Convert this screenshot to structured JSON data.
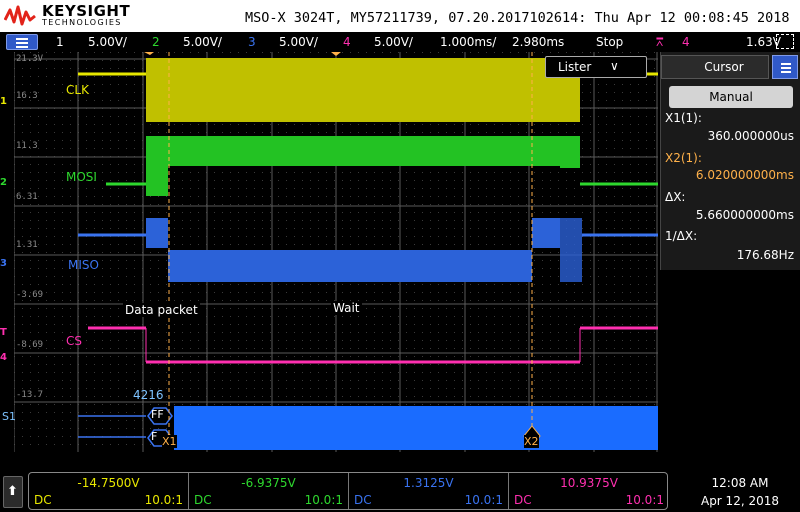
{
  "header": {
    "brand": "KEYSIGHT",
    "brand_sub": "TECHNOLOGIES",
    "model_line": "MSO-X 3024T, MY57211739, 07.20.2017102614: Thu Apr 12 00:08:45 2018"
  },
  "channel_bar": {
    "ch1_num": "1",
    "ch1_scale": "5.00V/",
    "ch2_num": "2",
    "ch2_scale": "5.00V/",
    "ch3_num": "3",
    "ch3_scale": "5.00V/",
    "ch4_num": "4",
    "ch4_scale": "5.00V/",
    "timebase": "1.000ms/",
    "delay": "2.980ms",
    "run_state": "Stop",
    "trigger_icon": "trigger-edge-icon",
    "trigger_source": "4",
    "trigger_level": "1.63V"
  },
  "grid": {
    "levels": [
      "21.3V",
      "16.3",
      "11.3",
      "6.31",
      "1.31",
      "-3.69",
      "-8.69",
      "-13.7"
    ]
  },
  "signals": {
    "clk_label": "CLK",
    "mosi_label": "MOSI",
    "miso_label": "MISO",
    "cs_label": "CS"
  },
  "annotations": {
    "data_packet": "Data packet",
    "wait": "Wait",
    "bus_value": "4216",
    "bus_sym_top": "FF",
    "bus_sym_bottom": "F",
    "bus_name": "S1",
    "x1_marker": "X1",
    "x2_marker": "X2"
  },
  "gutter": {
    "ch1": "1",
    "ch2": "2",
    "ch3": "3",
    "ch4": "4",
    "trig": "T"
  },
  "listener": {
    "label": "Lister",
    "chevron": "∨"
  },
  "cursor_panel": {
    "title": "Cursor",
    "mode_button": "Manual",
    "x1_label": "X1(1):",
    "x1_value": "360.000000us",
    "x2_label": "X2(1):",
    "x2_value": "6.020000000ms",
    "dx_label": "ΔX:",
    "dx_value": "5.660000000ms",
    "inv_dx_label": "1/ΔX:",
    "inv_dx_value": "176.68Hz"
  },
  "channels_bottom": [
    {
      "offset": "-14.7500V",
      "coupling": "DC",
      "probe": "10.0:1"
    },
    {
      "offset": "-6.9375V",
      "coupling": "DC",
      "probe": "10.0:1"
    },
    {
      "offset": "1.3125V",
      "coupling": "DC",
      "probe": "10.0:1"
    },
    {
      "offset": "10.9375V",
      "coupling": "DC",
      "probe": "10.0:1"
    }
  ],
  "clock": {
    "time": "12:08 AM",
    "date": "Apr 12, 2018"
  },
  "colors": {
    "ch1": "#e8e800",
    "ch2": "#2ed82e",
    "ch3": "#3a73f0",
    "ch4": "#ff2fb0",
    "cursor": "#ffb14a",
    "bus": "#1a6cff"
  }
}
